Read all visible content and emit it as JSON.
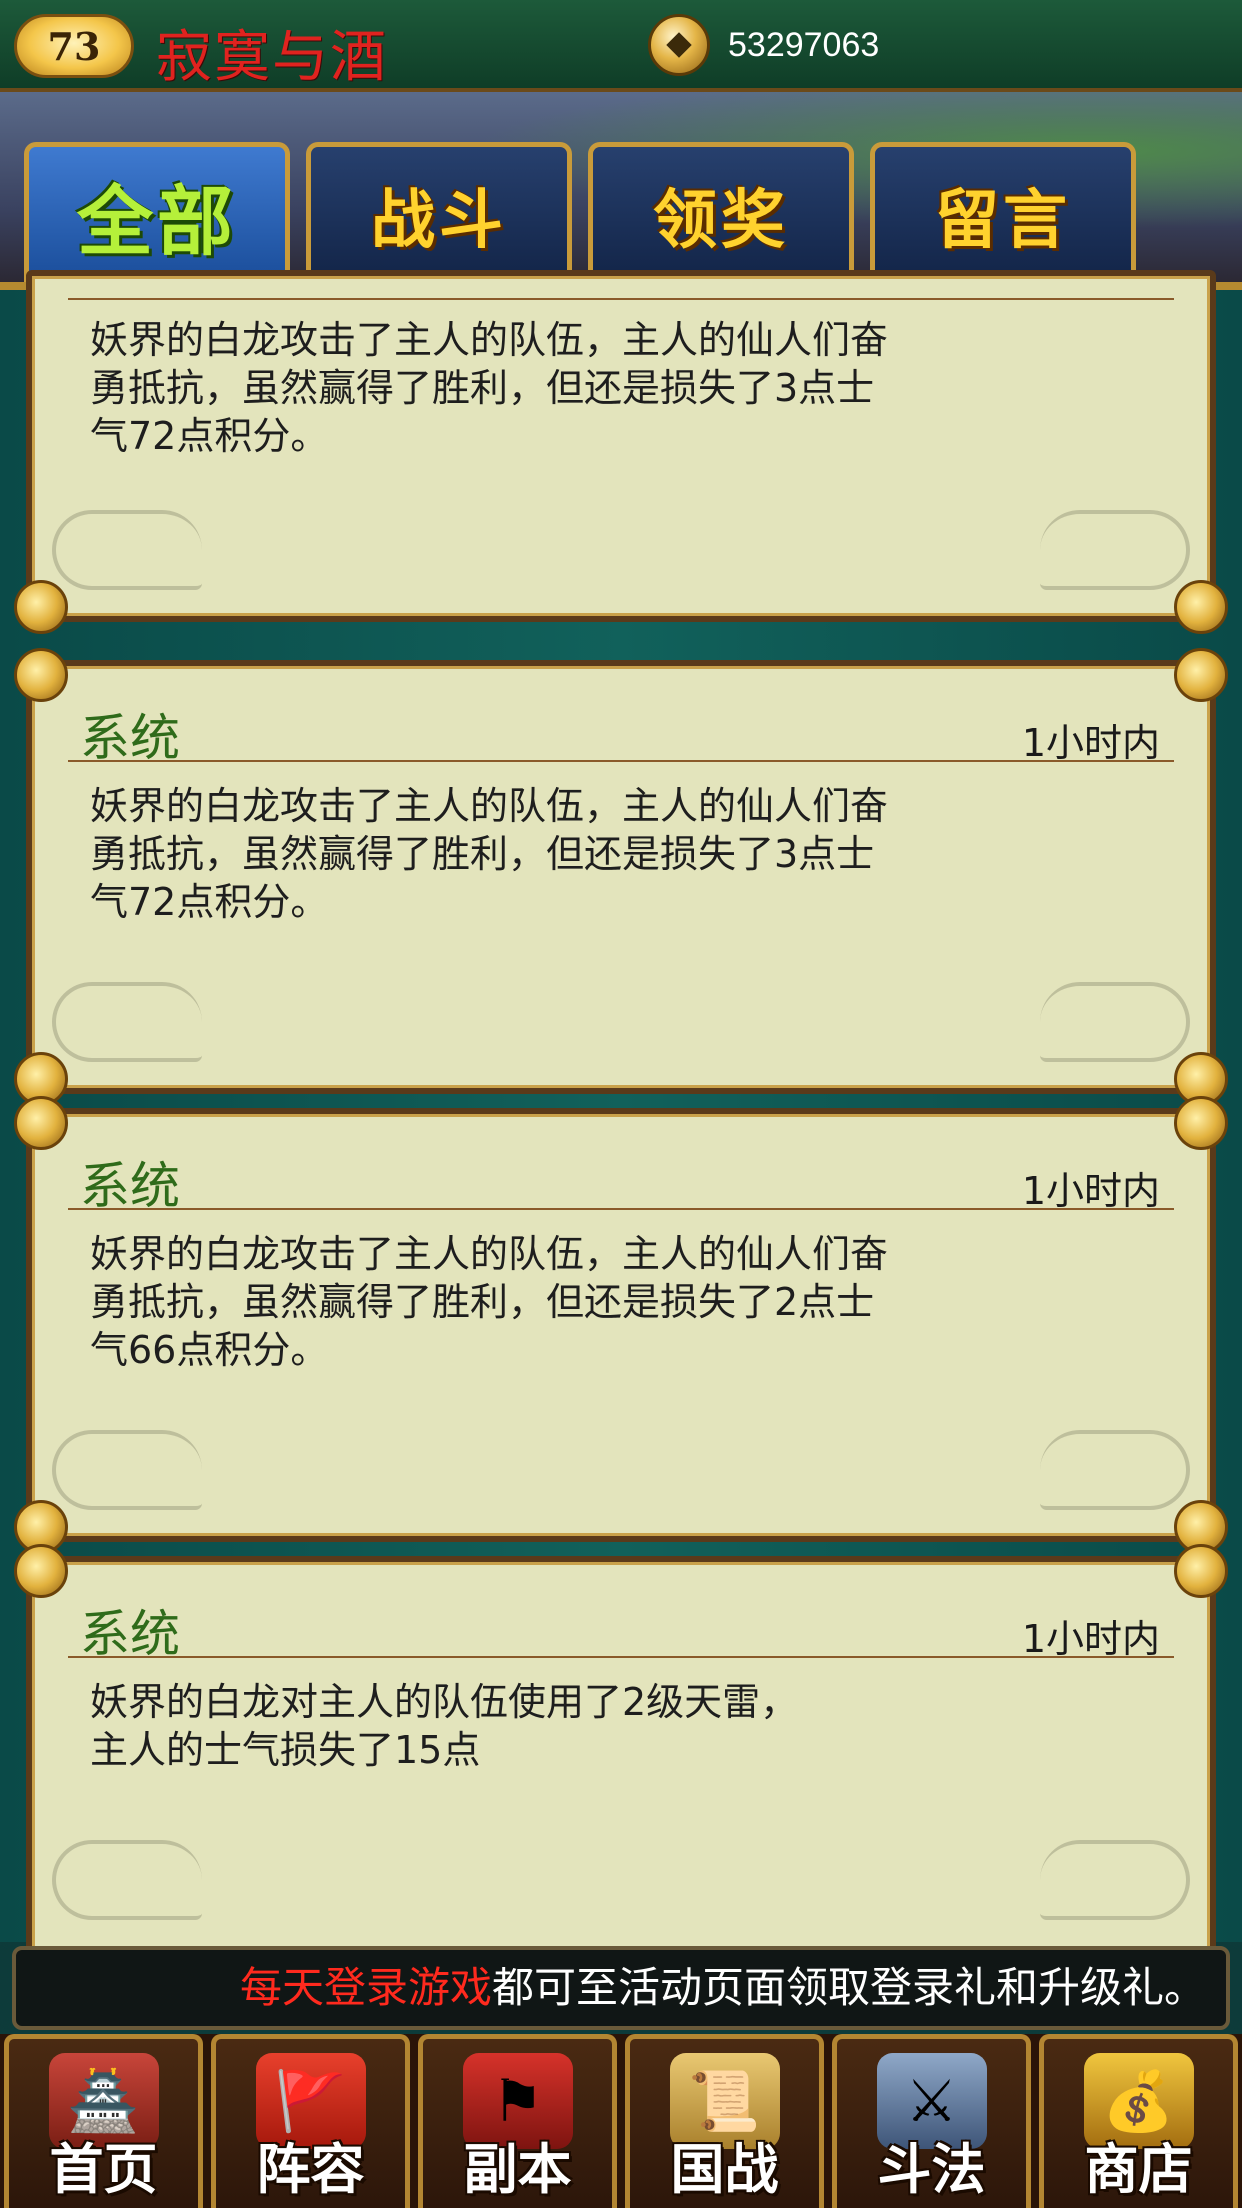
{
  "header": {
    "level": "73",
    "player_name": "寂寞与酒",
    "coins": "53297063"
  },
  "tabs": [
    {
      "label": "全部",
      "active": true
    },
    {
      "label": "战斗",
      "active": false
    },
    {
      "label": "领奖",
      "active": false
    },
    {
      "label": "留言",
      "active": false
    }
  ],
  "messages": [
    {
      "sender": "",
      "time": "",
      "body": "妖界的白龙攻击了主人的队伍，主人的仙人们奋勇抵抗，虽然赢得了胜利，但还是损失了3点士气72点积分。"
    },
    {
      "sender": "系统",
      "time": "1小时内",
      "body": "妖界的白龙攻击了主人的队伍，主人的仙人们奋勇抵抗，虽然赢得了胜利，但还是损失了3点士气72点积分。"
    },
    {
      "sender": "系统",
      "time": "1小时内",
      "body": "妖界的白龙攻击了主人的队伍，主人的仙人们奋勇抵抗，虽然赢得了胜利，但还是损失了2点士气66点积分。"
    },
    {
      "sender": "系统",
      "time": "1小时内",
      "body": "妖界的白龙对主人的队伍使用了2级天雷，主人的士气损失了15点"
    }
  ],
  "ticker": {
    "highlight": "每天登录游戏",
    "text": "都可至活动页面领取登录礼和升级礼。"
  },
  "nav": [
    {
      "label": "首页",
      "icon": "house-icon"
    },
    {
      "label": "阵容",
      "icon": "formation-flag-icon"
    },
    {
      "label": "副本",
      "icon": "battle-banner-icon"
    },
    {
      "label": "国战",
      "icon": "war-scroll-icon"
    },
    {
      "label": "斗法",
      "icon": "crossed-swords-icon"
    },
    {
      "label": "商店",
      "icon": "treasure-chest-icon"
    }
  ],
  "colors": {
    "player_name": "#e0231f",
    "sender": "#2f6b1a",
    "ticker_highlight": "#ff2a1e",
    "card_bg": "#e3e4bc"
  }
}
